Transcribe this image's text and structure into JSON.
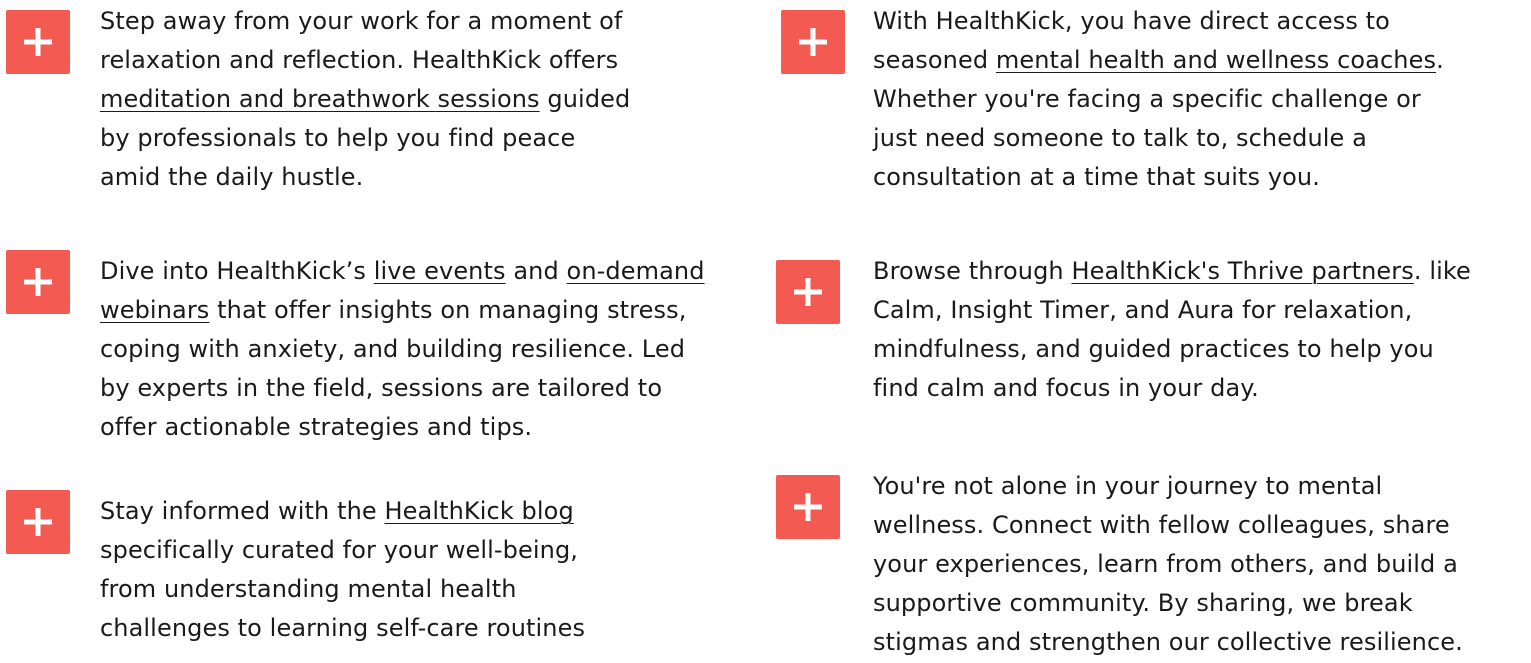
{
  "accent_color": "#f35b52",
  "icon": "plus-icon",
  "items": [
    {
      "lines": [
        [
          {
            "t": "Step away from your work for a moment of"
          }
        ],
        [
          {
            "t": "relaxation and reflection. HealthKick offers"
          }
        ],
        [
          {
            "t": "meditation and breathwork sessions",
            "link": true
          },
          {
            "t": " guided"
          }
        ],
        [
          {
            "t": "by professionals to help you find peace"
          }
        ],
        [
          {
            "t": "amid the daily hustle."
          }
        ]
      ]
    },
    {
      "lines": [
        [
          {
            "t": "Dive into HealthKick’s "
          },
          {
            "t": "live events",
            "link": true
          },
          {
            "t": " and "
          },
          {
            "t": "on-demand",
            "link": true
          }
        ],
        [
          {
            "t": "webinars",
            "link": true
          },
          {
            "t": " that offer insights on managing stress,"
          }
        ],
        [
          {
            "t": "coping with anxiety, and building resilience. Led"
          }
        ],
        [
          {
            "t": "by experts in the field, sessions are tailored to"
          }
        ],
        [
          {
            "t": "offer actionable strategies and tips."
          }
        ]
      ]
    },
    {
      "lines": [
        [
          {
            "t": "Stay informed with the "
          },
          {
            "t": "HealthKick blog",
            "link": true
          }
        ],
        [
          {
            "t": "specifically curated for your well-being,"
          }
        ],
        [
          {
            "t": "from understanding mental health"
          }
        ],
        [
          {
            "t": "challenges to learning self-care routines"
          }
        ]
      ]
    },
    {
      "lines": [
        [
          {
            "t": "With HealthKick, you have direct access to"
          }
        ],
        [
          {
            "t": "seasoned "
          },
          {
            "t": "mental health and wellness coaches",
            "link": true
          },
          {
            "t": "."
          }
        ],
        [
          {
            "t": "Whether you're facing a specific challenge or"
          }
        ],
        [
          {
            "t": "just need someone to talk to, schedule a"
          }
        ],
        [
          {
            "t": "consultation at a time that suits you."
          }
        ]
      ]
    },
    {
      "lines": [
        [
          {
            "t": "Browse through "
          },
          {
            "t": "HealthKick's Thrive partners",
            "link": true
          },
          {
            "t": ". like"
          }
        ],
        [
          {
            "t": "Calm, Insight Timer, and Aura for relaxation,"
          }
        ],
        [
          {
            "t": "mindfulness, and guided practices to help you"
          }
        ],
        [
          {
            "t": "find calm and focus in your day."
          }
        ]
      ]
    },
    {
      "lines": [
        [
          {
            "t": "You're not alone in your journey to mental"
          }
        ],
        [
          {
            "t": "wellness. Connect with fellow colleagues, share"
          }
        ],
        [
          {
            "t": "your experiences, learn from others, and build a"
          }
        ],
        [
          {
            "t": "supportive community. By sharing, we break"
          }
        ],
        [
          {
            "t": "stigmas and strengthen our collective resilience."
          }
        ]
      ]
    }
  ]
}
